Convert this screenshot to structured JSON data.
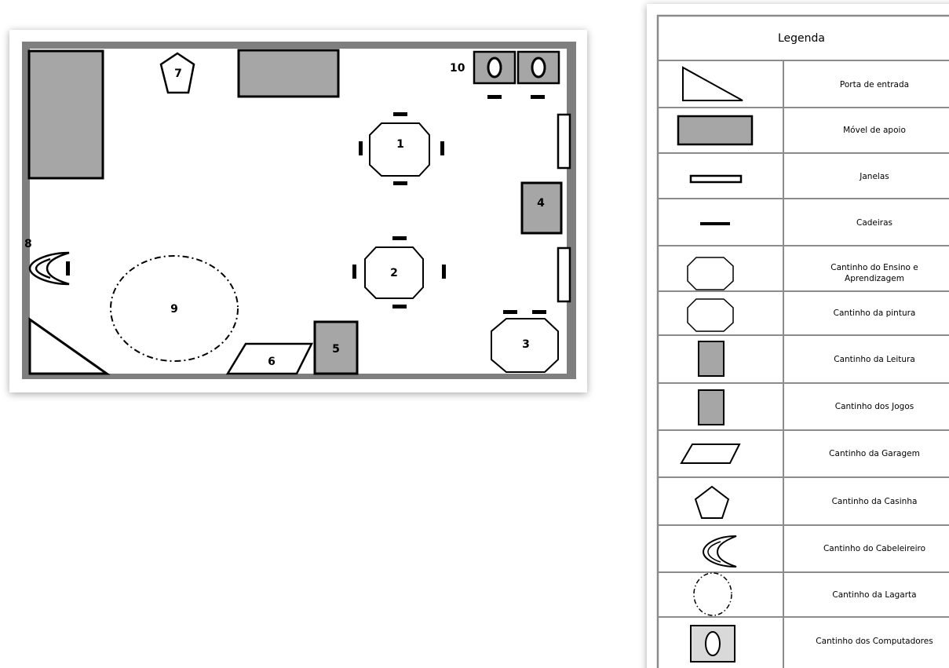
{
  "plan": {
    "labels": {
      "n1": "1",
      "n2": "2",
      "n3": "3",
      "n4": "4",
      "n5": "5",
      "n6": "6",
      "n7": "7",
      "n8": "8",
      "n9": "9",
      "n10": "10"
    }
  },
  "legend": {
    "title": "Legenda",
    "rows": [
      {
        "symbol": "triangle-icon",
        "label": "Porta de entrada"
      },
      {
        "symbol": "gray-rectangle-icon",
        "label": "Móvel de apoio"
      },
      {
        "symbol": "window-icon",
        "label": "Janelas"
      },
      {
        "symbol": "chair-icon",
        "label": "Cadeiras"
      },
      {
        "symbol": "octagon-icon",
        "label": "Cantinho do Ensino e",
        "label2": "Aprendizagem"
      },
      {
        "symbol": "octagon-icon",
        "label": "Cantinho da pintura"
      },
      {
        "symbol": "gray-square-icon",
        "label": "Cantinho da Leitura"
      },
      {
        "symbol": "gray-square-icon",
        "label": "Cantinho dos Jogos"
      },
      {
        "symbol": "parallelogram-icon",
        "label": "Cantinho da Garagem"
      },
      {
        "symbol": "pentagon-icon",
        "label": "Cantinho da Casinha"
      },
      {
        "symbol": "crescent-icon",
        "label": "Cantinho do Cabeleireiro"
      },
      {
        "symbol": "dashed-circle-icon",
        "label": "Cantinho da Lagarta"
      },
      {
        "symbol": "computer-icon",
        "label": "Cantinho dos Computadores"
      }
    ]
  },
  "colors": {
    "wall": "#7f7f7f",
    "furniture": "#a6a6a6",
    "line": "#000000"
  }
}
